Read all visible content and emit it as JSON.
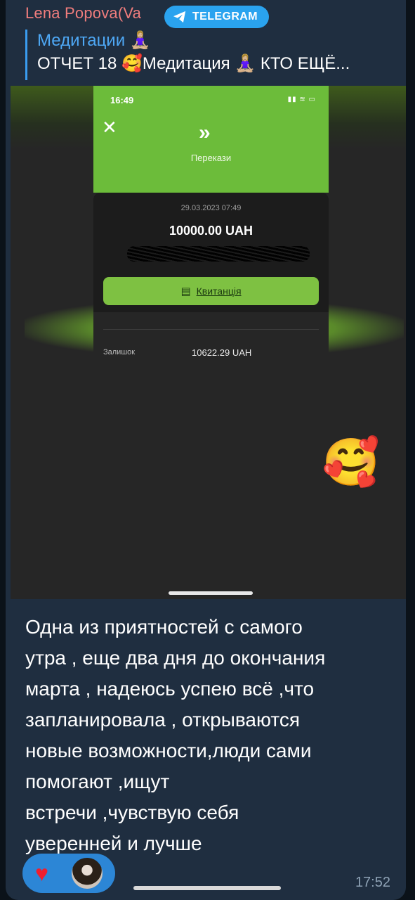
{
  "header": {
    "sender": "Lena Popova(Va",
    "badge_label": "TELEGRAM"
  },
  "reply": {
    "title": "Медитации 🧘🏼‍♀️",
    "text": "ОТЧЕТ 18 🥰Медитация 🧘🏼‍♀️ КТО ЕЩЁ..."
  },
  "screenshot": {
    "time": "16:49",
    "status": "▮▮ ≋ ▭",
    "close": "✕",
    "chevron": "»",
    "title": "Перекази",
    "date": "29.03.2023 07:49",
    "amount": "10000.00 UAH",
    "receipt_icon": "▤",
    "receipt_label": "Квитанція",
    "balance_label": "Залишок",
    "balance_value": "10622.29 UAH"
  },
  "sticker": "🥰",
  "message": {
    "text": "Одна из приятностей с самого\nутра , еще два дня до окончания\nмарта , надеюсь успею всё ,что\nзапланировала , открываются\nновые возможности,люди сами\nпомогают ,ищут\nвстречи ,чувствую себя\nуверенней и лучше"
  },
  "reactions": {
    "emoji": "♥"
  },
  "time": "17:52",
  "colors": {
    "bubble": "#1f2e40",
    "accent": "#2aa3ef",
    "sender": "#f07d7d",
    "bank_green": "#6cbc3a"
  }
}
